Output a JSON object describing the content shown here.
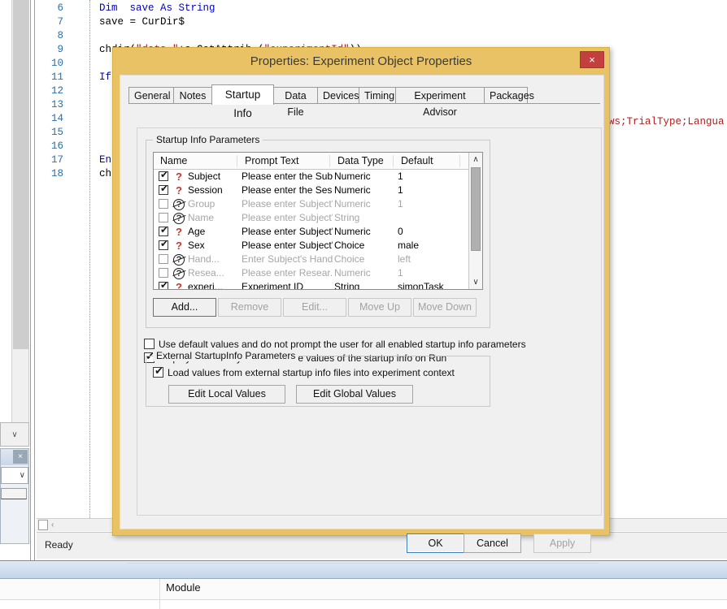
{
  "ide": {
    "status_text": "Ready",
    "code_lines": [
      {
        "no": "6",
        "segments": [
          {
            "t": "Dim  save As String",
            "c": "kw"
          }
        ]
      },
      {
        "no": "7",
        "segments": [
          {
            "t": "save = CurDir$",
            "c": "plain"
          }
        ]
      },
      {
        "no": "8",
        "segments": [
          {
            "t": "",
            "c": "plain"
          }
        ]
      },
      {
        "no": "9",
        "segments": [
          {
            "t": "chdir(",
            "c": "plain"
          },
          {
            "t": "\"data \"",
            "c": "str"
          },
          {
            "t": "+c.GetAttrib (",
            "c": "plain"
          },
          {
            "t": "\"experimentId\"",
            "c": "str"
          },
          {
            "t": "))",
            "c": "plain"
          }
        ]
      },
      {
        "no": "10",
        "segments": [
          {
            "t": "",
            "c": "plain"
          }
        ]
      },
      {
        "no": "11",
        "segments": [
          {
            "t": "If",
            "c": "kw"
          }
        ]
      },
      {
        "no": "12",
        "segments": [
          {
            "t": "",
            "c": "plain"
          }
        ]
      },
      {
        "no": "13",
        "segments": [
          {
            "t": "",
            "c": "plain"
          }
        ]
      },
      {
        "no": "14",
        "segments": [
          {
            "t": "",
            "c": "plain"
          }
        ]
      },
      {
        "no": "15",
        "segments": [
          {
            "t": "",
            "c": "plain"
          }
        ]
      },
      {
        "no": "16",
        "segments": [
          {
            "t": "",
            "c": "plain"
          }
        ]
      },
      {
        "no": "17",
        "segments": [
          {
            "t": "En",
            "c": "kw"
          }
        ]
      },
      {
        "no": "18",
        "segments": [
          {
            "t": "ch",
            "c": "plain"
          }
        ]
      }
    ],
    "right_snippet": "ws;TrialType;Langua",
    "hscroll_arrow": "‹",
    "left_scroll_arrow_down": "∨",
    "dock_panel": {
      "close_label": "×",
      "combo_arrow": "∨"
    },
    "panel_left_edge_label": "∨"
  },
  "bottom_window": {
    "columns": [
      "",
      "Module"
    ],
    "row": {
      "col_a": "",
      "col_b": ""
    }
  },
  "dialog": {
    "title": "Properties: Experiment Object Properties",
    "close_label": "×",
    "tabs": [
      {
        "label": "General",
        "active": false
      },
      {
        "label": "Notes",
        "active": false
      },
      {
        "label": "Startup Info",
        "active": true
      },
      {
        "label": "Data File",
        "active": false
      },
      {
        "label": "Devices",
        "active": false
      },
      {
        "label": "Timing",
        "active": false
      },
      {
        "label": "Experiment Advisor",
        "active": false
      },
      {
        "label": "Packages",
        "active": false
      }
    ],
    "startup_info": {
      "group_legend": "Startup Info Parameters",
      "grid": {
        "headers": [
          "Name",
          "Prompt Text",
          "Data Type",
          "Default"
        ],
        "scrollbar": {
          "up": "∧",
          "down": "∨"
        },
        "rows": [
          {
            "checked": true,
            "enabled": true,
            "name": "Subject",
            "prompt": "Please enter the Sub...",
            "type": "Numeric",
            "default": "1"
          },
          {
            "checked": true,
            "enabled": true,
            "name": "Session",
            "prompt": "Please enter the Ses...",
            "type": "Numeric",
            "default": "1"
          },
          {
            "checked": false,
            "enabled": false,
            "name": "Group",
            "prompt": "Please enter Subject'...",
            "type": "Numeric",
            "default": "1"
          },
          {
            "checked": false,
            "enabled": false,
            "name": "Name",
            "prompt": "Please enter Subject'...",
            "type": "String",
            "default": ""
          },
          {
            "checked": true,
            "enabled": true,
            "name": "Age",
            "prompt": "Please enter Subject'...",
            "type": "Numeric",
            "default": "0"
          },
          {
            "checked": true,
            "enabled": true,
            "name": "Sex",
            "prompt": "Please enter Subject'...",
            "type": "Choice",
            "default": "male"
          },
          {
            "checked": false,
            "enabled": false,
            "name": "Hand...",
            "prompt": "Enter Subject's Hand...",
            "type": "Choice",
            "default": "left"
          },
          {
            "checked": false,
            "enabled": false,
            "name": "Resea...",
            "prompt": "Please enter Resear...",
            "type": "Numeric",
            "default": "1"
          },
          {
            "checked": true,
            "enabled": true,
            "name": "experi...",
            "prompt": "Experiment ID",
            "type": "String",
            "default": "simonTask"
          }
        ]
      },
      "grid_buttons": [
        {
          "label": "Add...",
          "enabled": true,
          "default": true
        },
        {
          "label": "Remove",
          "enabled": false,
          "default": false
        },
        {
          "label": "Edit...",
          "enabled": false,
          "default": false
        },
        {
          "label": "Move Up",
          "enabled": false,
          "default": false
        },
        {
          "label": "Move Down",
          "enabled": false,
          "default": false
        }
      ],
      "options": [
        {
          "label": "Use default values and do not prompt the user for all enabled startup info parameters",
          "checked": false
        },
        {
          "label": "Display a summary to confirm the values of the startup info on Run",
          "checked": true
        }
      ],
      "external_group": {
        "legend": "External StartupInfo Parameters",
        "checkbox": {
          "label": "Load values from external startup info files into experiment context",
          "checked": true
        },
        "buttons": [
          {
            "label": "Edit Local Values"
          },
          {
            "label": "Edit Global Values"
          }
        ]
      }
    },
    "footer_buttons": [
      {
        "label": "OK",
        "enabled": true,
        "focused": true
      },
      {
        "label": "Cancel",
        "enabled": true,
        "focused": false
      },
      {
        "label": "Apply",
        "enabled": false,
        "focused": false
      }
    ]
  },
  "colors": {
    "dialog_frame": "#e8c264",
    "dialog_face": "#f0f0f0",
    "close_button": "#c34040",
    "accent_focus": "#3d7ebf",
    "code_keyword": "#0000c8",
    "code_string": "#b02020",
    "line_number": "#2b6ea8"
  },
  "checkmark_glyph": "✔"
}
